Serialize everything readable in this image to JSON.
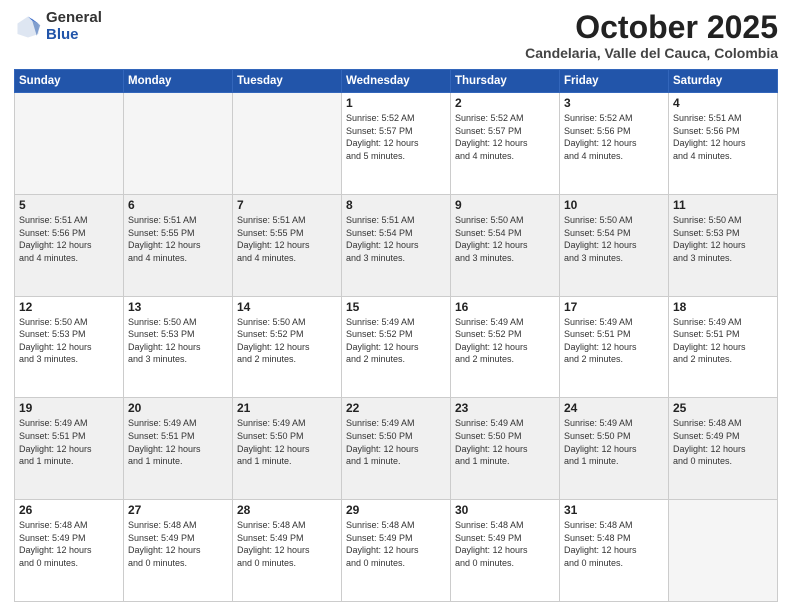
{
  "header": {
    "logo_general": "General",
    "logo_blue": "Blue",
    "month_title": "October 2025",
    "subtitle": "Candelaria, Valle del Cauca, Colombia"
  },
  "weekdays": [
    "Sunday",
    "Monday",
    "Tuesday",
    "Wednesday",
    "Thursday",
    "Friday",
    "Saturday"
  ],
  "weeks": [
    {
      "shaded": false,
      "days": [
        {
          "num": "",
          "info": ""
        },
        {
          "num": "",
          "info": ""
        },
        {
          "num": "",
          "info": ""
        },
        {
          "num": "1",
          "info": "Sunrise: 5:52 AM\nSunset: 5:57 PM\nDaylight: 12 hours\nand 5 minutes."
        },
        {
          "num": "2",
          "info": "Sunrise: 5:52 AM\nSunset: 5:57 PM\nDaylight: 12 hours\nand 4 minutes."
        },
        {
          "num": "3",
          "info": "Sunrise: 5:52 AM\nSunset: 5:56 PM\nDaylight: 12 hours\nand 4 minutes."
        },
        {
          "num": "4",
          "info": "Sunrise: 5:51 AM\nSunset: 5:56 PM\nDaylight: 12 hours\nand 4 minutes."
        }
      ]
    },
    {
      "shaded": true,
      "days": [
        {
          "num": "5",
          "info": "Sunrise: 5:51 AM\nSunset: 5:56 PM\nDaylight: 12 hours\nand 4 minutes."
        },
        {
          "num": "6",
          "info": "Sunrise: 5:51 AM\nSunset: 5:55 PM\nDaylight: 12 hours\nand 4 minutes."
        },
        {
          "num": "7",
          "info": "Sunrise: 5:51 AM\nSunset: 5:55 PM\nDaylight: 12 hours\nand 4 minutes."
        },
        {
          "num": "8",
          "info": "Sunrise: 5:51 AM\nSunset: 5:54 PM\nDaylight: 12 hours\nand 3 minutes."
        },
        {
          "num": "9",
          "info": "Sunrise: 5:50 AM\nSunset: 5:54 PM\nDaylight: 12 hours\nand 3 minutes."
        },
        {
          "num": "10",
          "info": "Sunrise: 5:50 AM\nSunset: 5:54 PM\nDaylight: 12 hours\nand 3 minutes."
        },
        {
          "num": "11",
          "info": "Sunrise: 5:50 AM\nSunset: 5:53 PM\nDaylight: 12 hours\nand 3 minutes."
        }
      ]
    },
    {
      "shaded": false,
      "days": [
        {
          "num": "12",
          "info": "Sunrise: 5:50 AM\nSunset: 5:53 PM\nDaylight: 12 hours\nand 3 minutes."
        },
        {
          "num": "13",
          "info": "Sunrise: 5:50 AM\nSunset: 5:53 PM\nDaylight: 12 hours\nand 3 minutes."
        },
        {
          "num": "14",
          "info": "Sunrise: 5:50 AM\nSunset: 5:52 PM\nDaylight: 12 hours\nand 2 minutes."
        },
        {
          "num": "15",
          "info": "Sunrise: 5:49 AM\nSunset: 5:52 PM\nDaylight: 12 hours\nand 2 minutes."
        },
        {
          "num": "16",
          "info": "Sunrise: 5:49 AM\nSunset: 5:52 PM\nDaylight: 12 hours\nand 2 minutes."
        },
        {
          "num": "17",
          "info": "Sunrise: 5:49 AM\nSunset: 5:51 PM\nDaylight: 12 hours\nand 2 minutes."
        },
        {
          "num": "18",
          "info": "Sunrise: 5:49 AM\nSunset: 5:51 PM\nDaylight: 12 hours\nand 2 minutes."
        }
      ]
    },
    {
      "shaded": true,
      "days": [
        {
          "num": "19",
          "info": "Sunrise: 5:49 AM\nSunset: 5:51 PM\nDaylight: 12 hours\nand 1 minute."
        },
        {
          "num": "20",
          "info": "Sunrise: 5:49 AM\nSunset: 5:51 PM\nDaylight: 12 hours\nand 1 minute."
        },
        {
          "num": "21",
          "info": "Sunrise: 5:49 AM\nSunset: 5:50 PM\nDaylight: 12 hours\nand 1 minute."
        },
        {
          "num": "22",
          "info": "Sunrise: 5:49 AM\nSunset: 5:50 PM\nDaylight: 12 hours\nand 1 minute."
        },
        {
          "num": "23",
          "info": "Sunrise: 5:49 AM\nSunset: 5:50 PM\nDaylight: 12 hours\nand 1 minute."
        },
        {
          "num": "24",
          "info": "Sunrise: 5:49 AM\nSunset: 5:50 PM\nDaylight: 12 hours\nand 1 minute."
        },
        {
          "num": "25",
          "info": "Sunrise: 5:48 AM\nSunset: 5:49 PM\nDaylight: 12 hours\nand 0 minutes."
        }
      ]
    },
    {
      "shaded": false,
      "days": [
        {
          "num": "26",
          "info": "Sunrise: 5:48 AM\nSunset: 5:49 PM\nDaylight: 12 hours\nand 0 minutes."
        },
        {
          "num": "27",
          "info": "Sunrise: 5:48 AM\nSunset: 5:49 PM\nDaylight: 12 hours\nand 0 minutes."
        },
        {
          "num": "28",
          "info": "Sunrise: 5:48 AM\nSunset: 5:49 PM\nDaylight: 12 hours\nand 0 minutes."
        },
        {
          "num": "29",
          "info": "Sunrise: 5:48 AM\nSunset: 5:49 PM\nDaylight: 12 hours\nand 0 minutes."
        },
        {
          "num": "30",
          "info": "Sunrise: 5:48 AM\nSunset: 5:49 PM\nDaylight: 12 hours\nand 0 minutes."
        },
        {
          "num": "31",
          "info": "Sunrise: 5:48 AM\nSunset: 5:48 PM\nDaylight: 12 hours\nand 0 minutes."
        },
        {
          "num": "",
          "info": ""
        }
      ]
    }
  ]
}
